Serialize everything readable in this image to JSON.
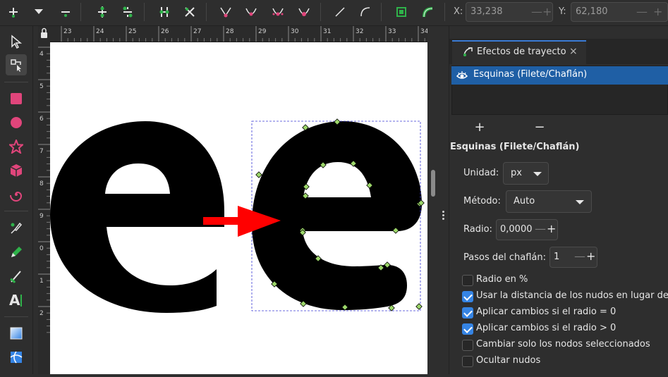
{
  "toolbar": {
    "x_label": "X:",
    "x_value": "33,238",
    "y_label": "Y:",
    "y_value": "62,180",
    "spin_minus": "—",
    "spin_plus": "+"
  },
  "ruler": {
    "ticks": [
      "23",
      "24",
      "25",
      "26",
      "27",
      "28",
      "29",
      "30",
      "31",
      "32",
      "33",
      "34"
    ],
    "vticks": [
      "4",
      "5",
      "6",
      "7",
      "8",
      "9",
      "0",
      "1",
      "2"
    ]
  },
  "panel": {
    "tab_title": "Efectos de trayecto",
    "tab_close": "×",
    "effect_item": "Esquinas (Filete/Chaflán)",
    "add": "+",
    "remove": "−",
    "effect_title": "Esquinas (Filete/Chaflán)",
    "unit_label": "Unidad:",
    "unit_value": "px",
    "method_label": "Método:",
    "method_value": "Auto",
    "radius_label": "Radio:",
    "radius_value": "0,0000",
    "steps_label": "Pasos del chaflán:",
    "steps_value": "1",
    "checkboxes": [
      {
        "label": "Radio en %",
        "checked": false
      },
      {
        "label": "Usar la distancia de los nudos en lugar de",
        "checked": true
      },
      {
        "label": "Aplicar cambios si el radio = 0",
        "checked": true
      },
      {
        "label": "Aplicar cambios si el radio > 0",
        "checked": true
      },
      {
        "label": "Cambiar solo los nodos seleccionados",
        "checked": false
      },
      {
        "label": "Ocultar nudos",
        "checked": false
      }
    ]
  },
  "colors": {
    "accent": "#3584e4",
    "selection_row": "#1f5fa5",
    "arrow": "#ff0000",
    "node_green": "#9cd66a",
    "tool_pink": "#e0457b",
    "tool_green": "#2fb24a"
  },
  "icons": {
    "path_effect_tab": "path-effect-icon",
    "visibility": "eye-icon"
  }
}
